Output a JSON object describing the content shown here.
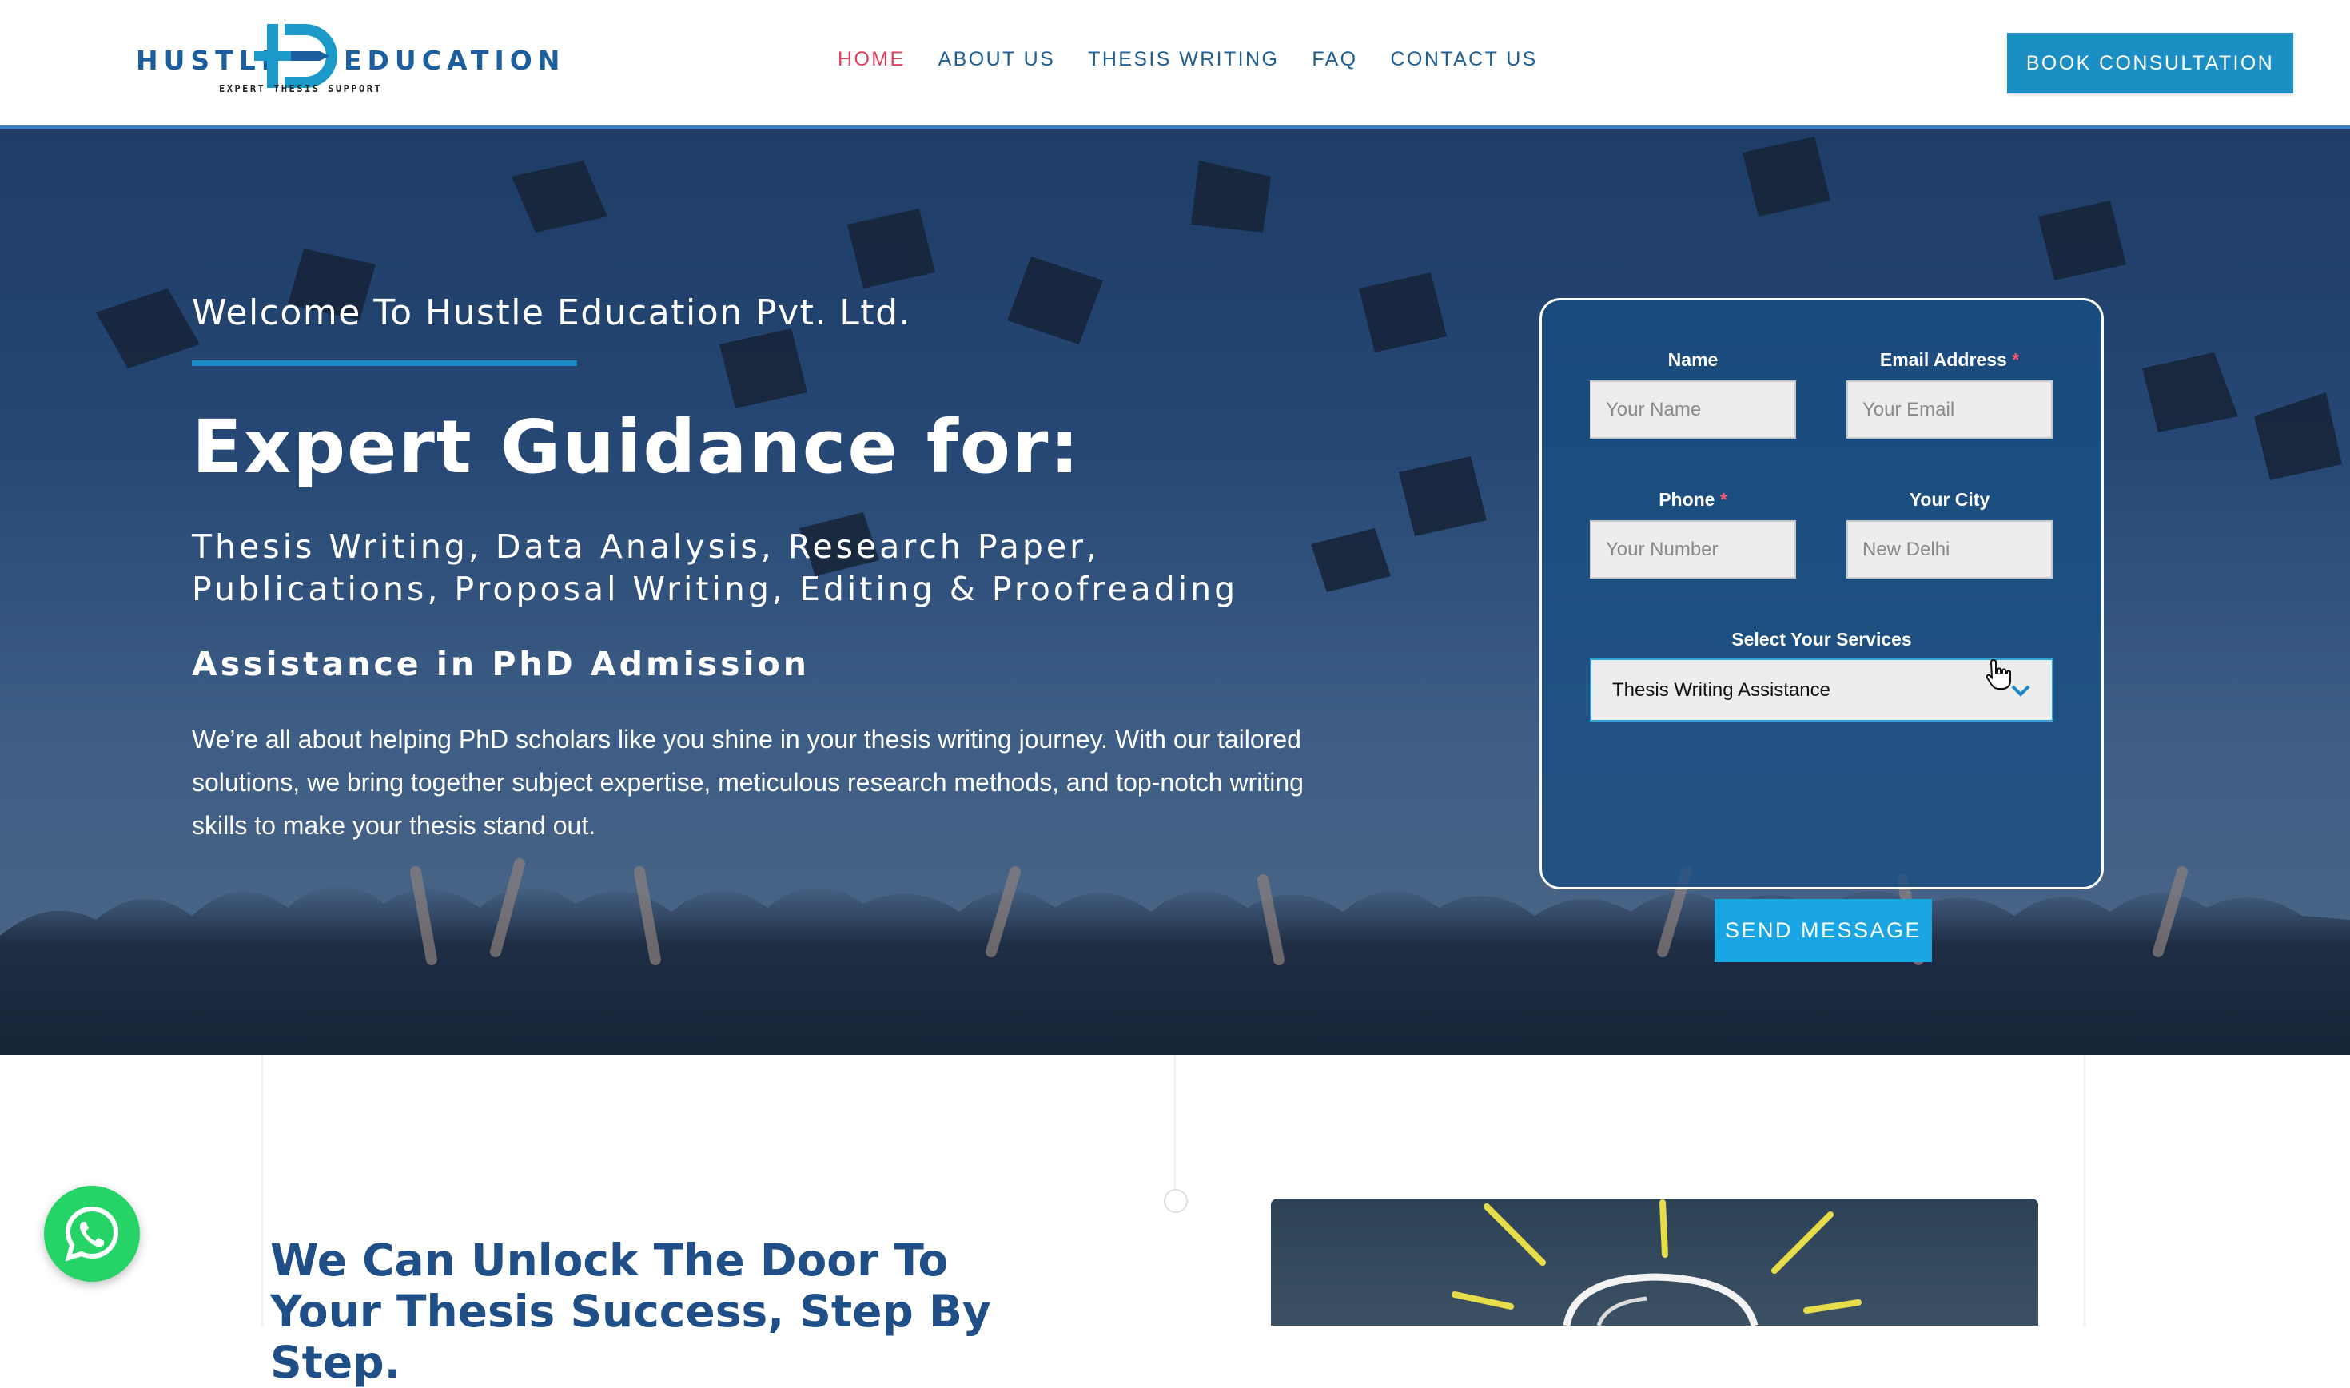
{
  "brand": {
    "word_left": "HUSTLE",
    "word_right": "EDUCATION",
    "tagline": "EXPERT THESIS SUPPORT",
    "color": "#1c5f9e"
  },
  "nav": {
    "items": [
      {
        "label": "HOME",
        "active": true
      },
      {
        "label": "ABOUT US",
        "active": false
      },
      {
        "label": "THESIS WRITING",
        "active": false
      },
      {
        "label": "FAQ",
        "active": false
      },
      {
        "label": "CONTACT US",
        "active": false
      }
    ],
    "cta_label": "BOOK CONSULTATION",
    "active_color": "#e0405f",
    "accent": "#1b8ec4"
  },
  "hero": {
    "welcome": "Welcome To Hustle Education Pvt. Ltd.",
    "headline": "Expert Guidance for:",
    "services": "Thesis Writing, Data Analysis, Research Paper, Publications, Proposal Writing, Editing & Proofreading",
    "phd": "Assistance in PhD Admission",
    "intro": "We’re all about helping PhD scholars like you shine in your thesis writing journey. With our tailored solutions, we bring together subject expertise, meticulous research methods, and top-notch writing skills to make your thesis stand out."
  },
  "form": {
    "name_label": "Name",
    "name_placeholder": "Your Name",
    "email_label": "Email Address",
    "email_placeholder": "Your Email",
    "phone_label": "Phone",
    "phone_placeholder": "Your Number",
    "city_label": "Your City",
    "city_placeholder": "New Delhi",
    "services_label": "Select Your Services",
    "services_selected": "Thesis Writing Assistance",
    "required_mark": "*",
    "submit_label": "SEND MESSAGE"
  },
  "section": {
    "title": "We Can Unlock The Door To Your Thesis Success, Step By Step."
  },
  "icons": [
    "logo-mark-icon",
    "chevron-down-icon",
    "hand-cursor-icon",
    "whatsapp-icon",
    "lightbulb-icon"
  ]
}
